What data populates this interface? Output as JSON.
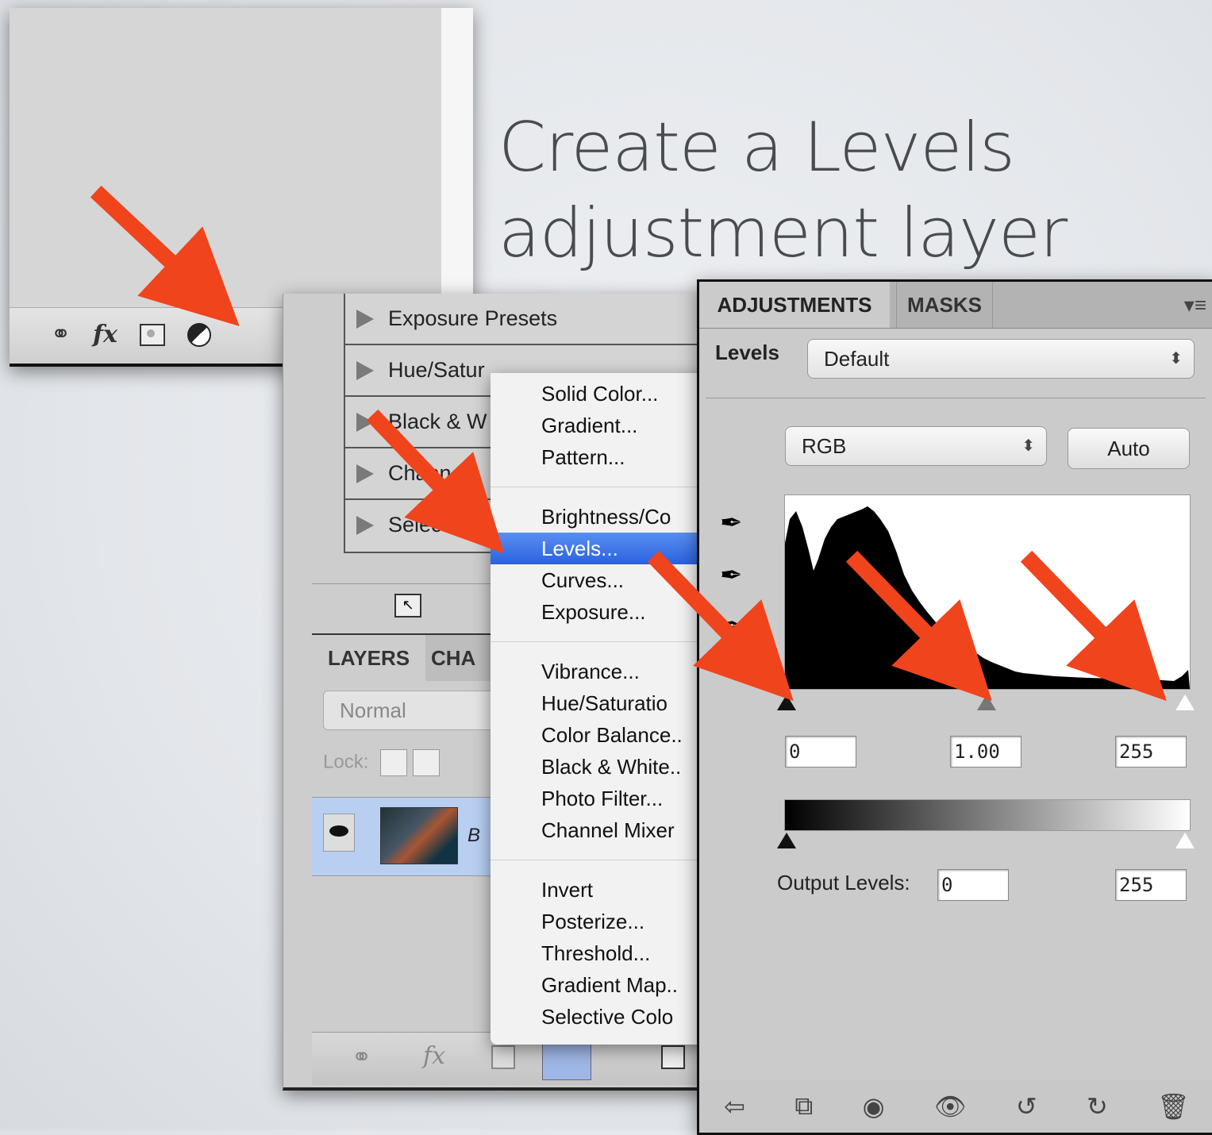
{
  "title": {
    "line1": "Create a Levels",
    "line2": "adjustment layer"
  },
  "top_crop": {
    "icons": [
      "link-icon",
      "fx-icon",
      "mask-icon",
      "adjustment-icon"
    ],
    "fx_label": "fx"
  },
  "presets": {
    "items": [
      "Exposure Presets",
      "Hue/Satur",
      "Black & W",
      "Channe",
      "Selectiv"
    ]
  },
  "layers_panel": {
    "tabs": [
      "LAYERS",
      "CHA"
    ],
    "blend_mode": "Normal",
    "lock_label": "Lock:",
    "layer_name": "B"
  },
  "menu": {
    "groups": [
      [
        "Solid Color...",
        "Gradient...",
        "Pattern..."
      ],
      [
        "Brightness/Co",
        "Levels...",
        "Curves...",
        "Exposure..."
      ],
      [
        "Vibrance...",
        "Hue/Saturatio",
        "Color Balance..",
        "Black & White..",
        "Photo Filter...",
        "Channel Mixer"
      ],
      [
        "Invert",
        "Posterize...",
        "Threshold...",
        "Gradient Map..",
        "Selective Colo"
      ]
    ],
    "selected": "Levels..."
  },
  "adjustments": {
    "tab_adjustments": "ADJUSTMENTS",
    "tab_masks": "MASKS",
    "panel_menu": "▾≡",
    "levels_label": "Levels",
    "preset_value": "Default",
    "channel_value": "RGB",
    "auto_label": "Auto",
    "input_black": "0",
    "input_gamma": "1.00",
    "input_white": "255",
    "output_label": "Output Levels:",
    "output_black": "0",
    "output_white": "255"
  },
  "colors": {
    "arrow": "#f0441d",
    "menu_selected": "#2f66e2",
    "layer_selected": "#b8cff2"
  }
}
